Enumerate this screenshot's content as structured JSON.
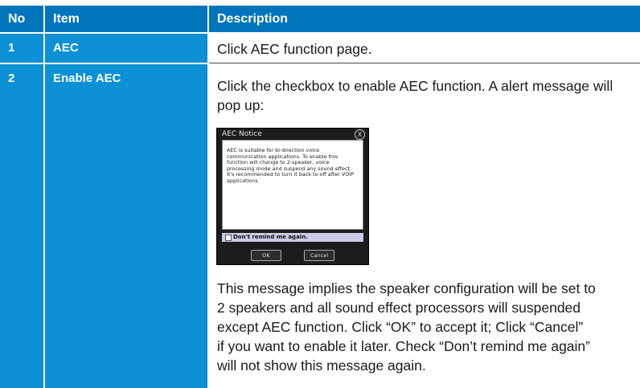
{
  "table": {
    "headers": {
      "no": "No",
      "item": "Item",
      "description": "Description"
    },
    "rows": [
      {
        "no": "1",
        "item": "AEC",
        "description": "Click AEC function page."
      },
      {
        "no": "2",
        "item": "Enable AEC",
        "description_intro": "Click the checkbox to enable AEC function. A alert message will pop up:",
        "description_lines": [
          "This message implies the speaker configuration will be set to",
          "2 speakers and all sound effect processors will suspended",
          "except AEC function. Click “OK” to accept it; Click “Cancel”",
          "if you want to enable it later. Check “Don’t remind me again”",
          "will not show this message again."
        ]
      }
    ]
  },
  "dialog": {
    "title": "AEC Notice",
    "close_glyph": "X",
    "message_lines": [
      "AEC is suitable for bi-direction voice",
      "communication applications. To enable this",
      "function will change to 2-speaker, voice",
      "processing mode and suspend any sound effect.",
      "It's recommended to turn it back to off after VOIP",
      "applications."
    ],
    "remind_label": "Don't remind me again.",
    "ok_label": "OK",
    "cancel_label": "Cancel"
  },
  "colors": {
    "header_blue": "#0075bc",
    "cell_blue": "#0c90d6",
    "dialog_dark": "#1c1c1c",
    "remind_bar": "#c9cbe8"
  }
}
